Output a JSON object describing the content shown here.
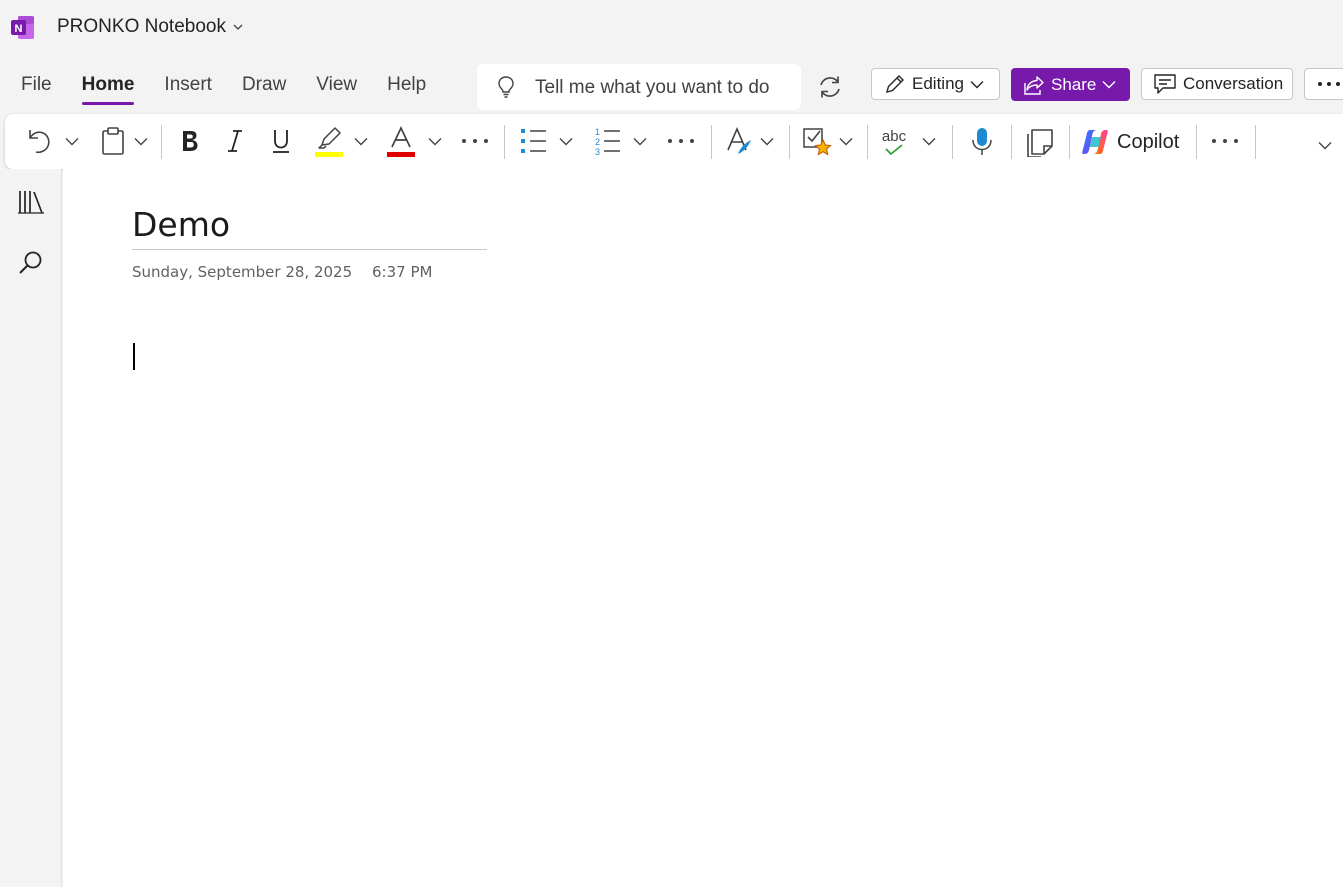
{
  "app": {
    "notebook_name": "PRONKO Notebook",
    "logo_letter": "N",
    "brand_color": "#7719aa"
  },
  "menu": {
    "tabs": [
      {
        "label": "File",
        "active": false
      },
      {
        "label": "Home",
        "active": true
      },
      {
        "label": "Insert",
        "active": false
      },
      {
        "label": "Draw",
        "active": false
      },
      {
        "label": "View",
        "active": false
      },
      {
        "label": "Help",
        "active": false
      }
    ]
  },
  "search": {
    "placeholder": "Tell me what you want to do",
    "icon": "lightbulb-icon"
  },
  "actions": {
    "editing_label": "Editing",
    "share_label": "Share",
    "conversation_label": "Conversation"
  },
  "ribbon": {
    "copilot_label": "Copilot",
    "highlight_color": "#ffff00",
    "font_color": "#e00000",
    "spell_text": "abc"
  },
  "page": {
    "title": "Demo",
    "date": "Sunday, September 28, 2025",
    "time": "6:37 PM"
  }
}
